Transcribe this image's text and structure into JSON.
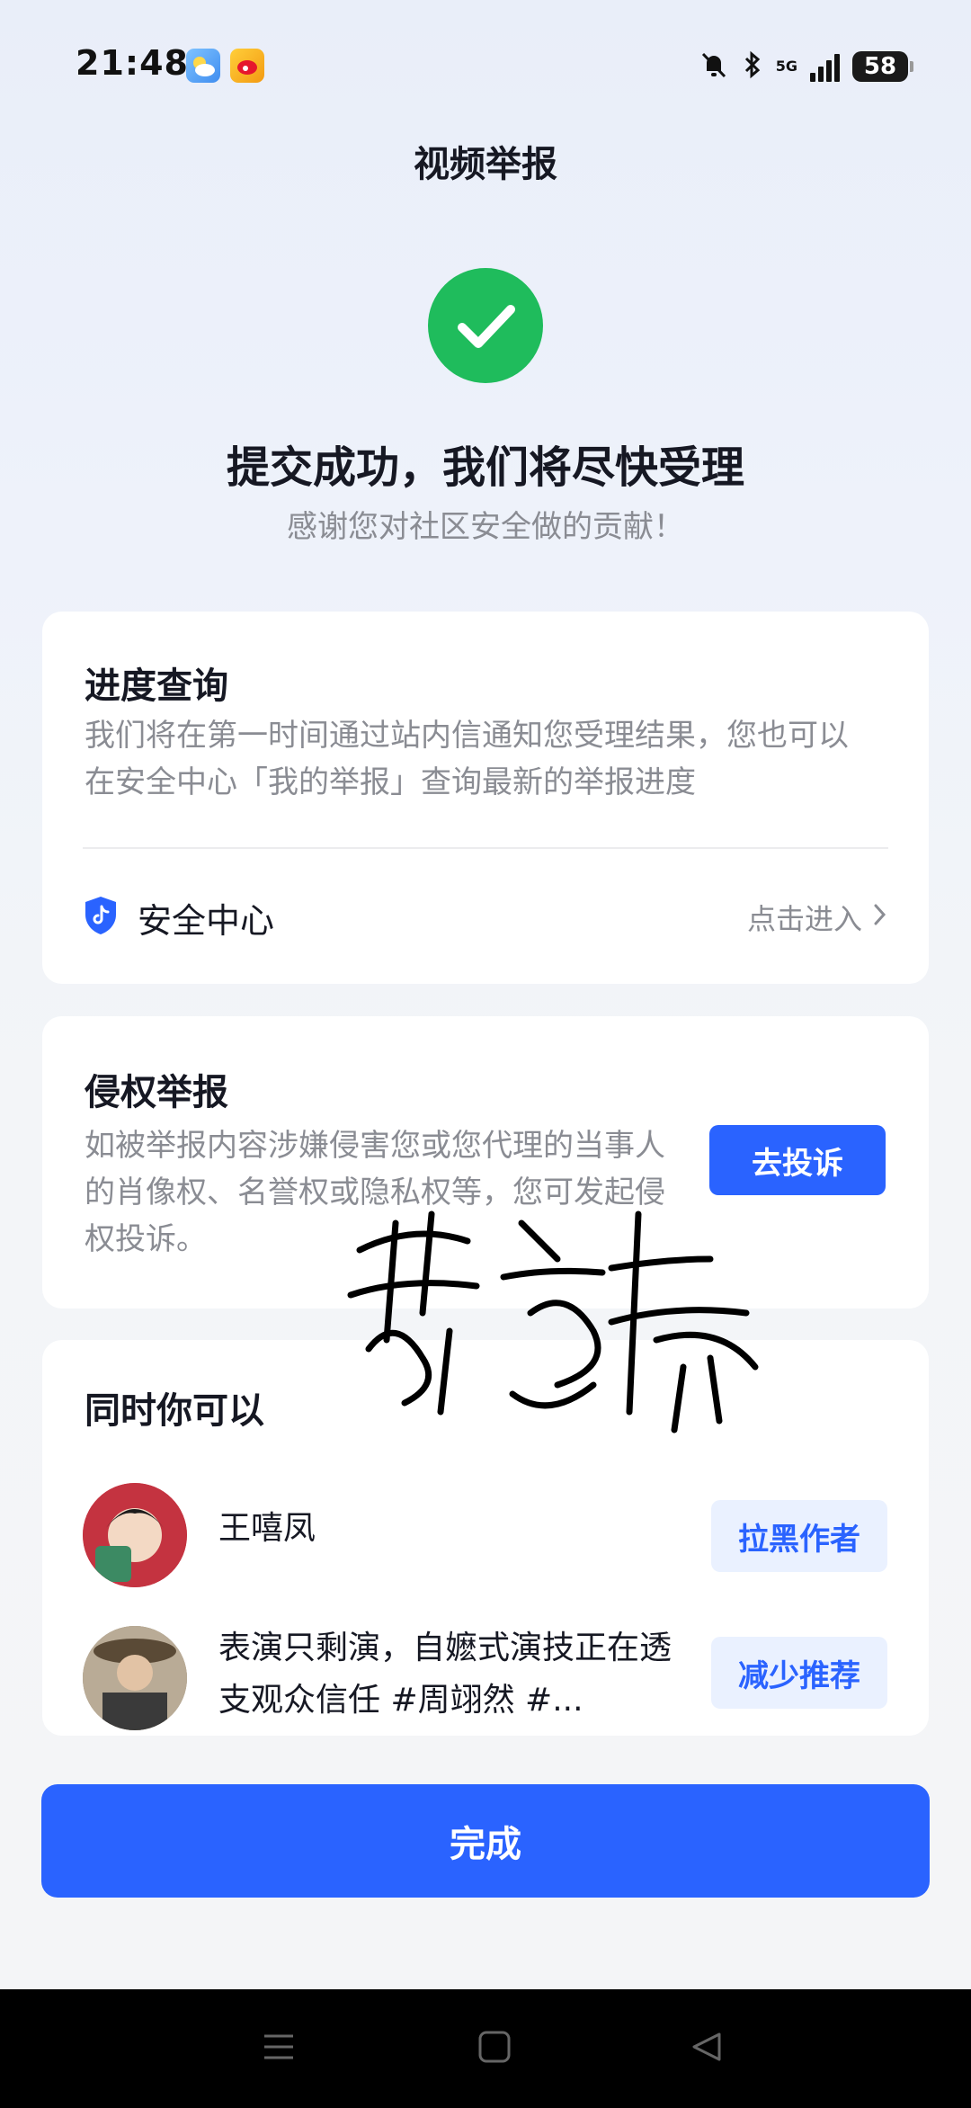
{
  "status_bar": {
    "time": "21:48",
    "network": "5G",
    "battery": "58"
  },
  "header": {
    "title": "视频举报"
  },
  "result": {
    "heading": "提交成功，我们将尽快受理",
    "subtitle": "感谢您对社区安全做的贡献！"
  },
  "progress_card": {
    "title": "进度查询",
    "description": "我们将在第一时间通过站内信通知您受理结果，您也可以在安全中心「我的举报」查询最新的举报进度",
    "security_center_label": "安全中心",
    "enter_label": "点击进入"
  },
  "rights_card": {
    "title": "侵权举报",
    "description": "如被举报内容涉嫌侵害您或您代理的当事人的肖像权、名誉权或隐私权等，您可发起侵权投诉。",
    "button_label": "去投诉"
  },
  "also_card": {
    "title": "同时你可以",
    "items": [
      {
        "text": "王嘻凤",
        "button_label": "拉黑作者"
      },
      {
        "text": "表演只剩演，自嬷式演技正在透支观众信任 #周翊然 #...",
        "button_label": "减少推荐"
      }
    ]
  },
  "footer": {
    "done_label": "完成"
  },
  "colors": {
    "accent": "#2a63ff",
    "success": "#1fbc5c",
    "text_secondary": "#8a8c93"
  },
  "icons": [
    "weather-icon",
    "weibo-icon",
    "bell-off-icon",
    "bluetooth-icon",
    "signal-icon",
    "battery-icon",
    "check-icon",
    "shield-icon",
    "chevron-right-icon",
    "menu-icon",
    "home-icon",
    "back-icon"
  ]
}
